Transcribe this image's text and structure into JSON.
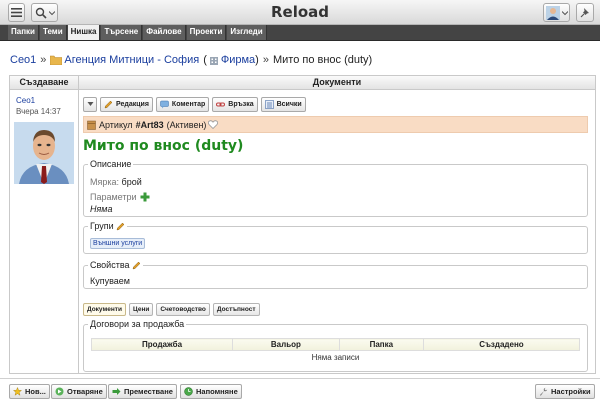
{
  "app": {
    "title": "Reload"
  },
  "nav": {
    "tabs": [
      "Папки",
      "Теми",
      "Нишка",
      "Търсене",
      "Файлове",
      "Проекти",
      "Изгледи"
    ],
    "active": "Нишка"
  },
  "breadcrumb": {
    "user": "Ceo1",
    "sep1": "»",
    "folder": "Агенция Митници - София",
    "paren_open": "(",
    "company": "Фирма",
    "paren_close": ")",
    "sep2": "»",
    "current": "Мито по внос (duty)"
  },
  "columns": {
    "left_header": "Създаване",
    "right_header": "Документи"
  },
  "creator": {
    "name": "Ceo1",
    "time": "Вчера 14:37"
  },
  "actions": {
    "edit": "Редакция",
    "comment": "Коментар",
    "link": "Връзка",
    "all": "Всички"
  },
  "article": {
    "prefix": "Артикул",
    "code": "#Art83",
    "status": "(Активен)",
    "title": "Мито по внос (duty)"
  },
  "description": {
    "legend": "Описание",
    "measure_label": "Мярка:",
    "measure_value": "брой",
    "params_label": "Параметри",
    "params_value": "Няма"
  },
  "groups": {
    "legend": "Групи",
    "tag": "Външни услуги"
  },
  "properties": {
    "legend": "Свойства",
    "value": "Купуваем"
  },
  "sub_tabs": [
    "Документи",
    "Цени",
    "Счетоводство",
    "Достъпност"
  ],
  "contracts": {
    "legend": "Договори за продажба",
    "columns": [
      "Продажба",
      "Вальор",
      "Папка",
      "Създадено"
    ],
    "empty": "Няма записи"
  },
  "footer": {
    "new": "Нов...",
    "open": "Отваряне",
    "move": "Преместване",
    "remind": "Напомняне",
    "settings": "Настройки"
  },
  "colors": {
    "title_green": "#1f8a1f",
    "link_blue": "#1a3e9e",
    "article_bg": "#f9dcc4",
    "nav_bg": "#444444"
  }
}
